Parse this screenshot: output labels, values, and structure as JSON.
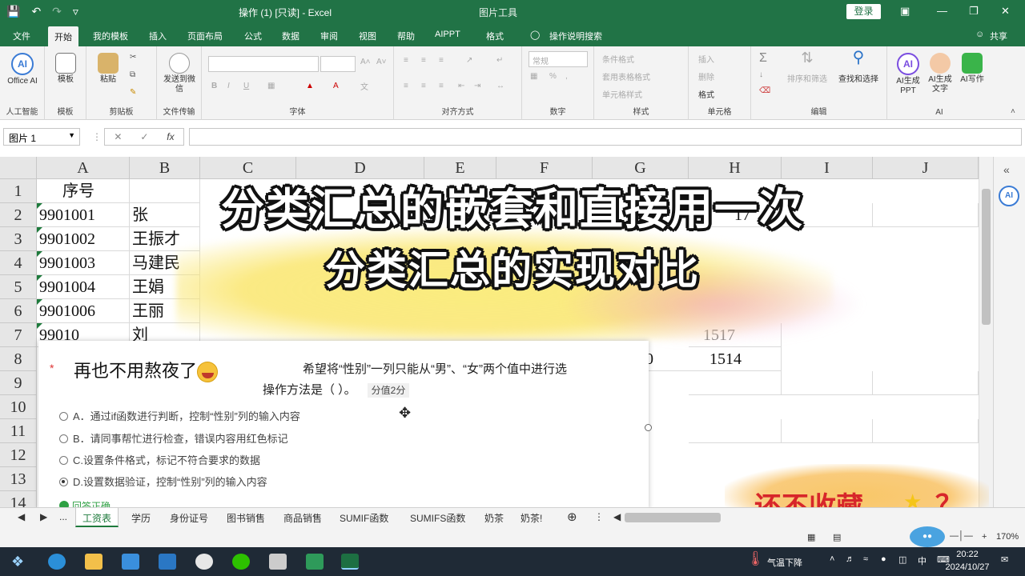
{
  "title_bar": {
    "document": "操作 (1)  [只读]  -  Excel",
    "context_tab": "图片工具",
    "login": "登录"
  },
  "ribbon_tabs": [
    "文件",
    "开始",
    "我的模板",
    "插入",
    "页面布局",
    "公式",
    "数据",
    "审阅",
    "视图",
    "帮助",
    "AIPPT",
    "格式"
  ],
  "active_tab": "开始",
  "tell_me": "操作说明搜索",
  "share": "共享",
  "ribbon": {
    "office_ai": "Office AI",
    "g_ai": "人工智能",
    "template": "模板",
    "g_template": "模板",
    "paste": "粘贴",
    "g_clipboard": "剪贴板",
    "send_wechat": "发送到微信",
    "g_transfer": "文件传输",
    "g_font": "字体",
    "g_align": "对齐方式",
    "number_format": "常规",
    "g_number": "数字",
    "cond_format": "条件格式",
    "table_format": "套用表格格式",
    "cell_style": "单元格样式",
    "g_style": "样式",
    "insert": "插入",
    "delete": "删除",
    "format": "格式",
    "g_cells": "单元格",
    "sort_filter": "排序和筛选",
    "find_select": "查找和选择",
    "g_edit": "编辑",
    "ai_ppt": "AI生成PPT",
    "ai_text": "AI生成文字",
    "ai_write": "AI写作",
    "g_ai2": "AI"
  },
  "name_box": "图片 1",
  "fx": "fx",
  "columns": [
    "A",
    "B",
    "C",
    "D",
    "E",
    "F",
    "G",
    "H",
    "I",
    "J"
  ],
  "rows": [
    "1",
    "2",
    "3",
    "4",
    "5",
    "6",
    "7",
    "8",
    "9",
    "10",
    "11",
    "12",
    "13",
    "14"
  ],
  "cells": {
    "a1": "序号",
    "a2": "9901001",
    "a3": "9901002",
    "a4": "9901003",
    "a5": "9901004",
    "a6": "9901006",
    "a7": "99010",
    "b2": "张",
    "b3": "王振才",
    "b4": "马建民",
    "b5": "王娟",
    "b6": "王丽",
    "b7": "刘",
    "h2": "17",
    "h7": "1517",
    "h8": "1514",
    "g8": "0"
  },
  "headline": {
    "line1": "分类汇总的嵌套和直接用一次",
    "line2": "分类汇总的实现对比"
  },
  "quiz": {
    "handwritten": "再也不用熬夜了",
    "question_1": "希望将“性别”一列只能从“男”、“女”两个值中进行选",
    "question_2": "操作方法是（ ）。",
    "score": "分值2分",
    "options": [
      "A．通过if函数进行判断，控制“性别”列的输入内容",
      "B．请同事帮忙进行检查，错误内容用红色标记",
      "C.设置条件格式，标记不符合要求的数据",
      "D.设置数据验证，控制“性别”列的输入内容"
    ],
    "selected": 3,
    "answer": "回答正确"
  },
  "save_prompt": {
    "text": "还不收藏",
    "q": "？"
  },
  "sheet_tabs": [
    "工资表",
    "学历",
    "身份证号",
    "图书销售",
    "商品销售",
    "SUMIF函数",
    "SUMIFS函数",
    "奶茶",
    "奶茶!"
  ],
  "active_sheet": "工资表",
  "zoom": "170%",
  "taskbar": {
    "weather": "气温下降",
    "ime": "中",
    "time": "20:22",
    "date": "2024/10/27"
  },
  "colors": {
    "excel_green": "#217346",
    "accent_red": "#d7262a"
  }
}
